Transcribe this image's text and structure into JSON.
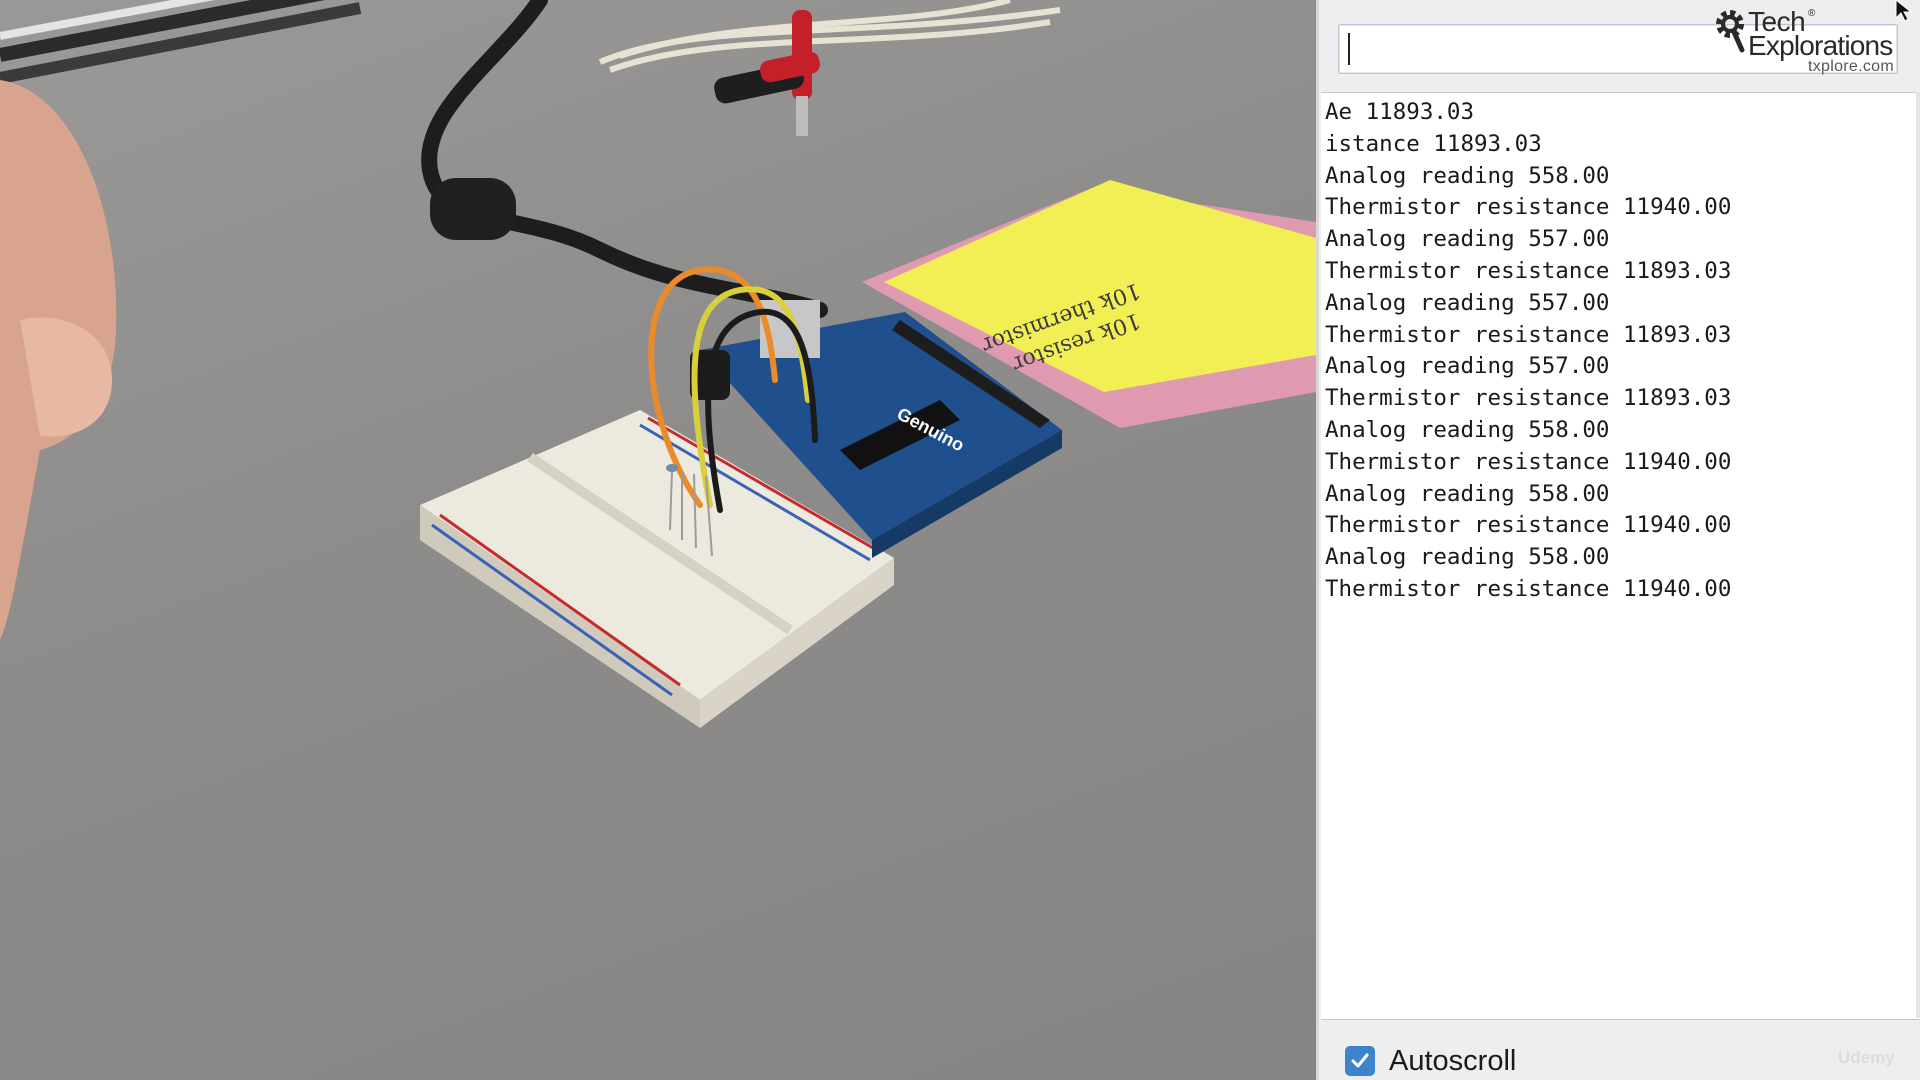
{
  "serial_monitor": {
    "input_value": "",
    "output_lines": [
      "Ae 11893.03",
      "istance 11893.03",
      "Analog reading 558.00",
      "Thermistor resistance 11940.00",
      "Analog reading 557.00",
      "Thermistor resistance 11893.03",
      "Analog reading 557.00",
      "Thermistor resistance 11893.03",
      "Analog reading 557.00",
      "Thermistor resistance 11893.03",
      "Analog reading 558.00",
      "Thermistor resistance 11940.00",
      "Analog reading 558.00",
      "Thermistor resistance 11940.00",
      "Analog reading 558.00",
      "Thermistor resistance 11940.00"
    ],
    "autoscroll": {
      "label": "Autoscroll",
      "checked": true
    }
  },
  "branding": {
    "name_line1": "Tech",
    "registered_mark": "®",
    "name_line2": "Explorations",
    "url": "txplore.com",
    "icon": "gear-icon"
  },
  "board": {
    "label": "Genuino"
  },
  "watermark": "Udemy",
  "colors": {
    "checkbox_accent": "#3c84cc",
    "sticky_note": "#f2ef55",
    "board_blue": "#1f4f8c",
    "orange_wire": "#e98b2a",
    "yellow_wire": "#d8cf3a"
  }
}
